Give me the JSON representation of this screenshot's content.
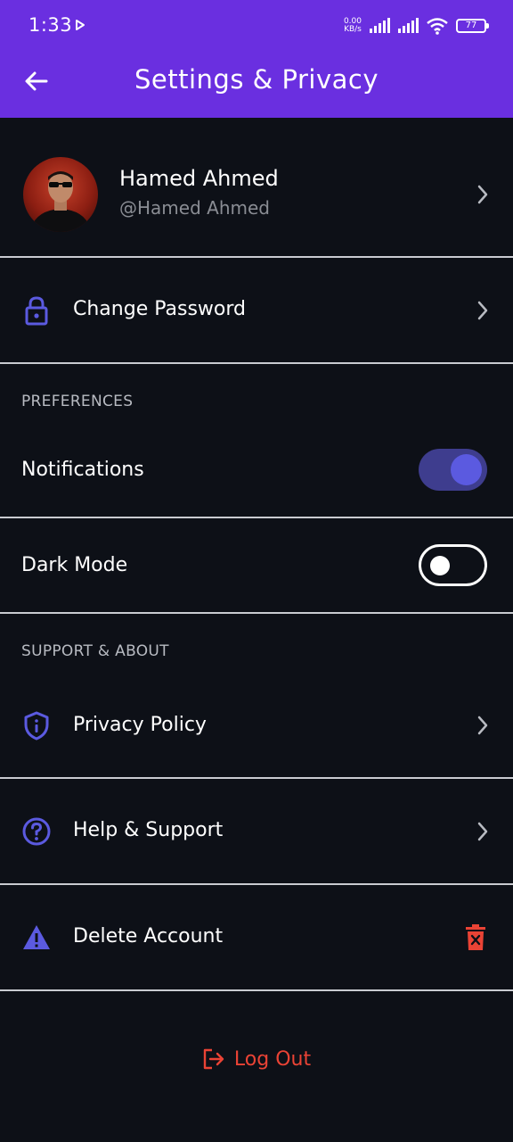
{
  "status_bar": {
    "time": "1:33",
    "net_speed_value": "0.00",
    "net_speed_unit": "KB/s",
    "battery": "77"
  },
  "app_bar": {
    "title": "Settings & Privacy",
    "back_icon": "arrow-left-icon"
  },
  "profile": {
    "name": "Hamed Ahmed",
    "handle": "@Hamed Ahmed"
  },
  "account": {
    "change_password_label": "Change Password",
    "change_password_icon": "lock-icon"
  },
  "preferences": {
    "header": "PREFERENCES",
    "notifications_label": "Notifications",
    "notifications_on": true,
    "dark_mode_label": "Dark Mode",
    "dark_mode_on": false
  },
  "support": {
    "header": "SUPPORT & ABOUT",
    "privacy_policy_label": "Privacy Policy",
    "help_support_label": "Help & Support",
    "delete_account_label": "Delete Account"
  },
  "logout": {
    "label": "Log Out"
  },
  "colors": {
    "app_bar": "#6a2fe0",
    "background": "#0d1017",
    "accent": "#5b5ae0",
    "danger": "#ea4335"
  }
}
